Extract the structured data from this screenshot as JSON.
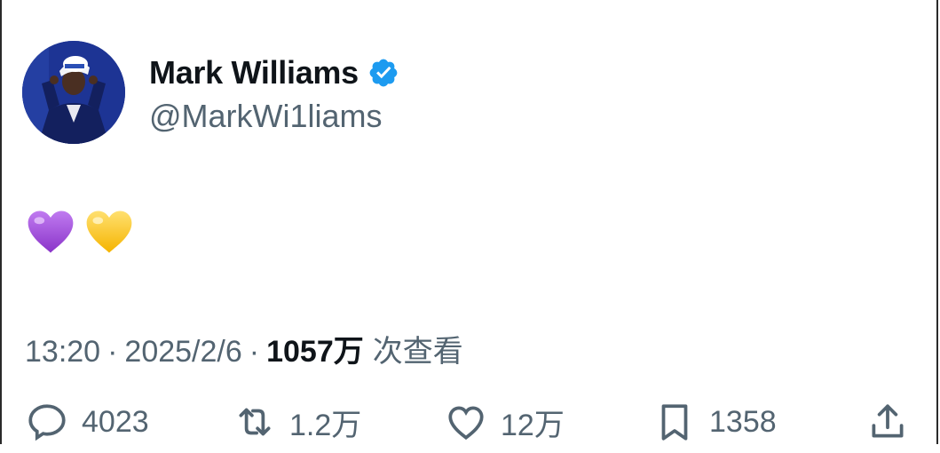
{
  "author": {
    "display_name": "Mark Williams",
    "handle": "@MarkWi1liams",
    "verified": true
  },
  "tweet": {
    "content_emojis": [
      "purple-heart",
      "yellow-heart"
    ],
    "time": "13:20",
    "date": "2025/2/6",
    "separator": "·",
    "views_count": "1057万",
    "views_label": "次查看"
  },
  "actions": {
    "replies": "4023",
    "reposts": "1.2万",
    "likes": "12万",
    "bookmarks": "1358"
  },
  "colors": {
    "verified_blue": "#1d9bf0",
    "secondary_text": "#536471",
    "primary_text": "#0f1419",
    "purple_heart": "#a64fe0",
    "yellow_heart": "#ffc83d"
  }
}
